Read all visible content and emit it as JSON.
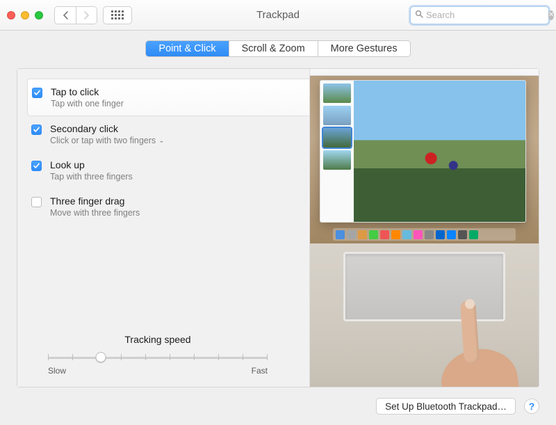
{
  "window": {
    "title": "Trackpad"
  },
  "search": {
    "placeholder": "Search",
    "value": ""
  },
  "tabs": [
    {
      "label": "Point & Click",
      "active": true
    },
    {
      "label": "Scroll & Zoom",
      "active": false
    },
    {
      "label": "More Gestures",
      "active": false
    }
  ],
  "options": [
    {
      "title": "Tap to click",
      "subtitle": "Tap with one finger",
      "checked": true,
      "selected": true,
      "dropdown": false
    },
    {
      "title": "Secondary click",
      "subtitle": "Click or tap with two fingers",
      "checked": true,
      "selected": false,
      "dropdown": true
    },
    {
      "title": "Look up",
      "subtitle": "Tap with three fingers",
      "checked": true,
      "selected": false,
      "dropdown": false
    },
    {
      "title": "Three finger drag",
      "subtitle": "Move with three fingers",
      "checked": false,
      "selected": false,
      "dropdown": false
    }
  ],
  "tracking": {
    "label": "Tracking speed",
    "min_label": "Slow",
    "max_label": "Fast",
    "ticks": 10,
    "value_index": 2
  },
  "footer": {
    "setup_button": "Set Up Bluetooth Trackpad…"
  }
}
